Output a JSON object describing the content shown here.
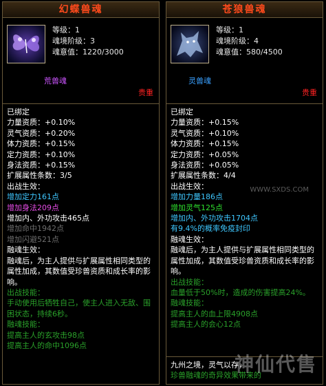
{
  "cards": [
    {
      "title": "幻蝶兽魂",
      "info": [
        "等级：1",
        "魂境阶级：3",
        "魂意值：1220/3000"
      ],
      "type": "荒兽魂",
      "rarity": "贵重",
      "lines": [
        {
          "t": "已绑定",
          "c": "white"
        },
        {
          "t": "力量资质：+0.10%",
          "c": "white"
        },
        {
          "t": "灵气资质：+0.20%",
          "c": "white"
        },
        {
          "t": "体力资质：+0.15%",
          "c": "white"
        },
        {
          "t": "定力资质：+0.10%",
          "c": "white"
        },
        {
          "t": "身法资质：+0.15%",
          "c": "white"
        },
        {
          "t": "扩展属性条数：3/5",
          "c": "white"
        },
        {
          "t": "出战生效：",
          "c": "white"
        },
        {
          "t": "增加定力161点",
          "c": "cyan"
        },
        {
          "t": "增加身法209点",
          "c": "pink"
        },
        {
          "t": "增加内、外功攻击465点",
          "c": "white"
        },
        {
          "t": "增加命中1942点",
          "c": "gray"
        },
        {
          "t": "增加闪避521点",
          "c": "gray"
        },
        {
          "t": "融魂生效：",
          "c": "white"
        },
        {
          "t": "融魂后，为主人提供与扩展属性相同类型的属性加成，其数值受珍兽资质和成长率的影响。",
          "c": "white"
        },
        {
          "t": "出战技能：",
          "c": "dkgreen"
        },
        {
          "t": "手动使用后牺牲自己，使主人进入无敌、围困状态，持续6秒。",
          "c": "dkgreen"
        },
        {
          "t": "融魂技能：",
          "c": "dkgreen"
        },
        {
          "t": "提高主人的玄攻击98点",
          "c": "dkgreen"
        },
        {
          "t": "提高主人的命中1096点",
          "c": "dkgreen"
        }
      ]
    },
    {
      "title": "苍狼兽魂",
      "info": [
        "等级：1",
        "魂境阶级：4",
        "魂意值：580/4500"
      ],
      "type": "灵兽魂",
      "rarity": "贵重",
      "lines": [
        {
          "t": "已绑定",
          "c": "white"
        },
        {
          "t": "力量资质：+0.15%",
          "c": "white"
        },
        {
          "t": "灵气资质：+0.10%",
          "c": "white"
        },
        {
          "t": "体力资质：+0.15%",
          "c": "white"
        },
        {
          "t": "定力资质：+0.05%",
          "c": "white"
        },
        {
          "t": "身法资质：+0.05%",
          "c": "white"
        },
        {
          "t": "扩展属性条数：4/4",
          "c": "white"
        },
        {
          "t": "出战生效：",
          "c": "white"
        },
        {
          "t": "增加力量186点",
          "c": "cyan"
        },
        {
          "t": "增加灵气125点",
          "c": "green"
        },
        {
          "t": "增加内、外功攻击1704点",
          "c": "cyan"
        },
        {
          "t": "有9.4%的概率免疫封印",
          "c": "cyan"
        },
        {
          "t": "融魂生效：",
          "c": "white"
        },
        {
          "t": "融魂后，为主人提供与扩展属性相同类型的属性加成，其数值受珍兽资质和成长率的影响。",
          "c": "white"
        },
        {
          "t": "出战技能：",
          "c": "dkgreen"
        },
        {
          "t": "血量低于50%时，造成的伤害提高24%。",
          "c": "dkgreen"
        },
        {
          "t": "融魂技能：",
          "c": "dkgreen"
        },
        {
          "t": "提高主人的血上限4908点",
          "c": "dkgreen"
        },
        {
          "t": "提高主人的会心12点",
          "c": "dkgreen"
        }
      ],
      "footer": [
        "九州之境，灵气以存，",
        "珍兽融魂的奇异效果带来的"
      ]
    }
  ],
  "watermark": "神仙代售",
  "watermark_url": "WWW.SXDS.COM"
}
